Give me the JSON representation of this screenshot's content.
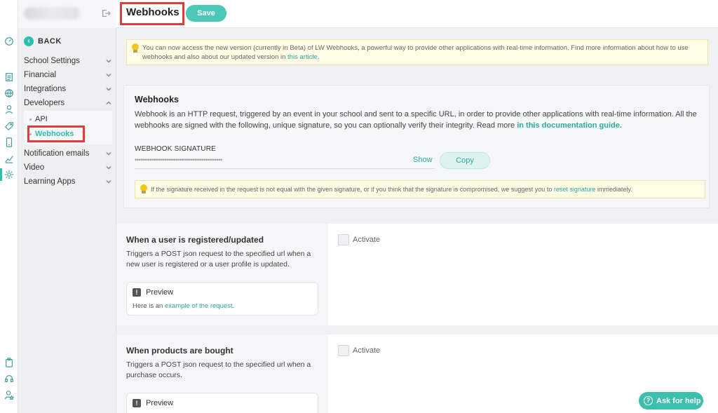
{
  "rail": {
    "icons": [
      "dashboard-icon",
      "document-icon",
      "globe-icon",
      "user-icon",
      "tag-icon",
      "mobile-icon",
      "analytics-icon",
      "settings-icon",
      "clipboard-icon",
      "headset-icon",
      "user-star-icon"
    ]
  },
  "sidebar": {
    "back_label": "BACK",
    "items": [
      {
        "label": "School Settings"
      },
      {
        "label": "Financial"
      },
      {
        "label": "Integrations"
      },
      {
        "label": "Developers"
      },
      {
        "label": "Notification emails"
      },
      {
        "label": "Video"
      },
      {
        "label": "Learning Apps"
      }
    ],
    "sub_items": [
      {
        "label": "API"
      },
      {
        "label": "Webhooks"
      }
    ]
  },
  "header": {
    "title": "Webhooks",
    "save_label": "Save"
  },
  "notice": {
    "text": "You can now access the new version (currently in Beta) of LW Webhooks, a powerful way to provide other applications with real-time information. Find more information about how to use webhooks and also about our updated version in ",
    "link": "this article",
    "end": "."
  },
  "webhooks_card": {
    "title": "Webhooks",
    "desc": "Webhook is an HTTP request, triggered by an event in your school and sent to a specific URL, in order to provide other applications with real-time information. All the webhooks are signed with the following, unique signature, so you can optionally verify their integrity. Read more ",
    "desc_link": "in this documentation guide.",
    "signature_label": "WEBHOOK SIGNATURE",
    "signature_value": "•••••••••••••••••••••••••••••••••••••••••••••••",
    "show_label": "Show",
    "copy_label": "Copy",
    "warning_text": "If the signature received in the request is not equal with the given signature, or if you think that the signature is compromised, we suggest you to ",
    "warning_link": "reset signature",
    "warning_end": " immediately."
  },
  "events": [
    {
      "title": "When a user is registered/updated",
      "desc": "Triggers a POST json request to the specified url when a new user is registered or a user profile is updated.",
      "preview_label": "Preview",
      "preview_text": "Here is an ",
      "preview_link": "example of the request",
      "preview_end": ".",
      "activate_label": "Activate"
    },
    {
      "title": "When products are bought",
      "desc": "Triggers a POST json request to the specified url when a purchase occurs.",
      "preview_label": "Preview",
      "activate_label": "Activate"
    }
  ],
  "help": {
    "label": "Ask for help"
  },
  "colors": {
    "accent": "#2fbfb0",
    "highlight": "#e53b3b",
    "notice_bg": "#fffde5"
  }
}
